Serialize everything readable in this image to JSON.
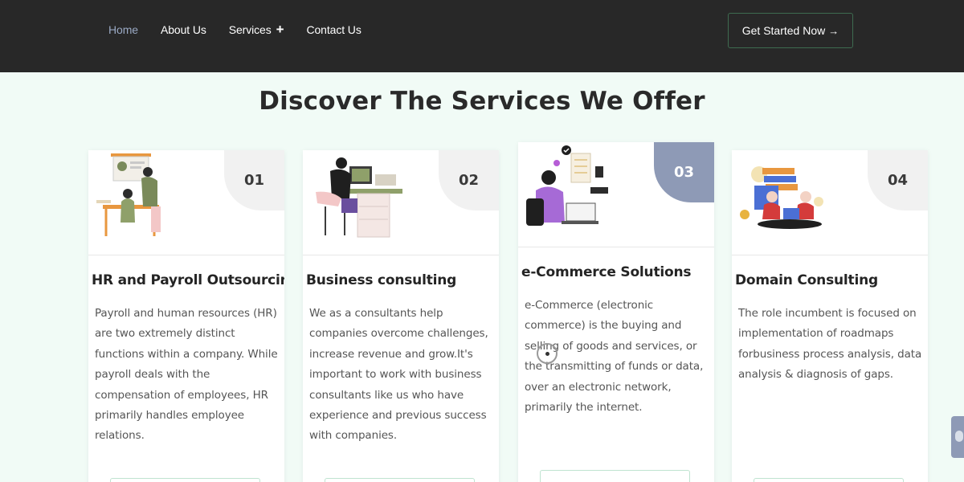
{
  "nav": {
    "items": [
      {
        "label": "Home",
        "active": true
      },
      {
        "label": "About Us",
        "active": false
      },
      {
        "label": "Services",
        "active": false
      },
      {
        "label": "Contact Us",
        "active": false
      }
    ],
    "services_expand_icon": "+",
    "cta_label": "Get Started Now",
    "cta_icon": "→"
  },
  "section": {
    "title": "Discover The Services We Offer"
  },
  "cards": [
    {
      "number": "01",
      "title": "HR and Payroll Outsourcing",
      "text": "Payroll and human resources (HR) are two extremely distinct functions within a company. While payroll deals with the compensation of employees, HR primarily handles employee relations.",
      "illustration": "hr-team-illustration"
    },
    {
      "number": "02",
      "title": "Business consulting",
      "text": "We as a consultants help companies overcome challenges, increase revenue and grow.It's important to work with business consultants like us who have experience and previous success with companies.",
      "illustration": "consultant-desk-illustration"
    },
    {
      "number": "03",
      "title": "e-Commerce Solutions",
      "text": "e-Commerce (electronic commerce) is the buying and selling of goods and services, or the transmitting of funds or data, over an electronic network, primarily the internet.",
      "illustration": "ecommerce-laptop-illustration",
      "highlighted": true
    },
    {
      "number": "04",
      "title": "Domain Consulting",
      "text": "The role incumbent is focused on implementation of roadmaps forbusiness process analysis, data analysis & diagnosis of gaps.",
      "illustration": "domain-meeting-illustration"
    }
  ],
  "colors": {
    "header_bg": "#282828",
    "page_bg": "#f1fbf6",
    "active_nav": "#9aa9c4",
    "highlight_badge": "#8e9ab6",
    "cta_border": "#3e6b50"
  }
}
